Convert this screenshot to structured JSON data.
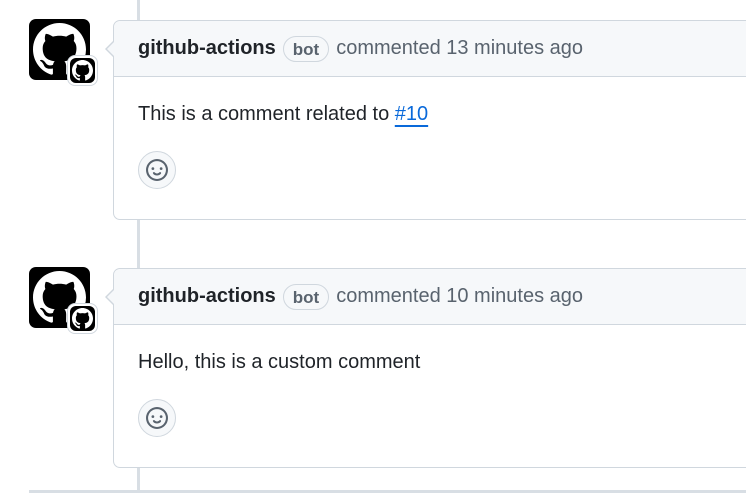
{
  "comments": [
    {
      "author": "github-actions",
      "badge": "bot",
      "meta": "commented 13 minutes ago",
      "body_text": "This is a comment related to ",
      "body_link": "#10"
    },
    {
      "author": "github-actions",
      "badge": "bot",
      "meta": "commented 10 minutes ago",
      "body_text": "Hello, this is a custom comment",
      "body_link": ""
    }
  ],
  "icons": {
    "avatar": "github-octocat-icon",
    "reaction": "smiley-icon"
  },
  "colors": {
    "link": "#0969da",
    "header_bg": "#f6f8fa",
    "border": "#d0d7de",
    "muted_text": "#59636e"
  }
}
